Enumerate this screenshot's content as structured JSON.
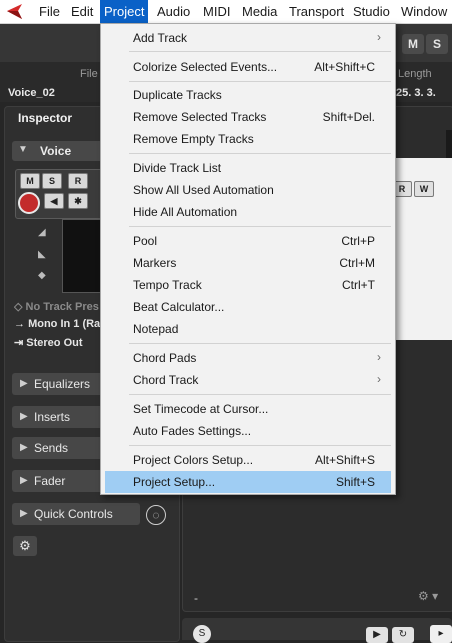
{
  "menubar": {
    "items": [
      {
        "label": "File"
      },
      {
        "label": "Edit"
      },
      {
        "label": "Project"
      },
      {
        "label": "Audio"
      },
      {
        "label": "MIDI"
      },
      {
        "label": "Media"
      },
      {
        "label": "Transport"
      },
      {
        "label": "Studio"
      },
      {
        "label": "Window"
      }
    ]
  },
  "toolbar": {
    "m_label": "M",
    "s_label": "S"
  },
  "info_strip": {
    "file_label": "File",
    "length_label": "Length",
    "event_name": "Voice_02",
    "length_value": "25. 3. 3."
  },
  "inspector": {
    "title": "Inspector",
    "track_name": "Voice",
    "buttons": {
      "m": "M",
      "s": "S",
      "r": "R"
    },
    "preset": "No Track Pres",
    "input": "Mono In 1 (Ra",
    "output": "Stereo Out",
    "sections": [
      "Equalizers",
      "Inserts",
      "Sends",
      "Fader",
      "Quick Controls"
    ]
  },
  "project_area": {
    "lane_buttons": {
      "r": "R",
      "w": "W"
    },
    "dash": "-"
  },
  "colors": {
    "menu_active": "#0a61c7",
    "menu_highlight": "#9fcdf3",
    "record": "#c32b2b"
  },
  "project_menu": {
    "items": [
      {
        "label": "Add Track",
        "shortcut": "",
        "submenu": true
      },
      {
        "label": "Colorize Selected Events...",
        "shortcut": "Alt+Shift+C"
      },
      {
        "label": "Duplicate Tracks",
        "shortcut": ""
      },
      {
        "label": "Remove Selected Tracks",
        "shortcut": "Shift+Del."
      },
      {
        "label": "Remove Empty Tracks",
        "shortcut": ""
      },
      {
        "label": "Divide Track List",
        "shortcut": ""
      },
      {
        "label": "Show All Used Automation",
        "shortcut": ""
      },
      {
        "label": "Hide All Automation",
        "shortcut": ""
      },
      {
        "label": "Pool",
        "shortcut": "Ctrl+P"
      },
      {
        "label": "Markers",
        "shortcut": "Ctrl+M"
      },
      {
        "label": "Tempo Track",
        "shortcut": "Ctrl+T"
      },
      {
        "label": "Beat Calculator...",
        "shortcut": ""
      },
      {
        "label": "Notepad",
        "shortcut": ""
      },
      {
        "label": "Chord Pads",
        "shortcut": "",
        "submenu": true
      },
      {
        "label": "Chord Track",
        "shortcut": "",
        "submenu": true
      },
      {
        "label": "Set Timecode at Cursor...",
        "shortcut": ""
      },
      {
        "label": "Auto Fades Settings...",
        "shortcut": ""
      },
      {
        "label": "Project Colors Setup...",
        "shortcut": "Alt+Shift+S"
      },
      {
        "label": "Project Setup...",
        "shortcut": "Shift+S",
        "highlighted": true
      }
    ]
  }
}
